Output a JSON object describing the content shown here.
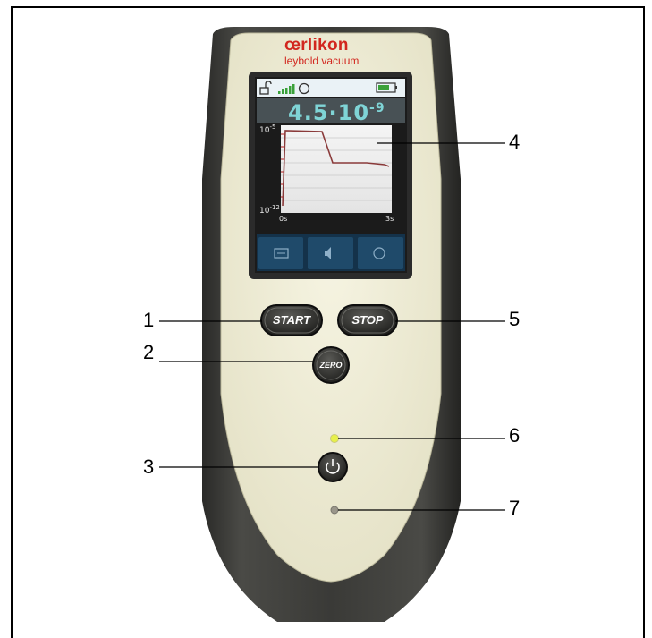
{
  "brand": {
    "name": "œrlikon",
    "subname": "leybold vacuum"
  },
  "screen": {
    "reading_mantissa": "4.5·10",
    "reading_exponent": "-9",
    "y_top_base": "10",
    "y_top_exp": "-5",
    "y_bottom_base": "10",
    "y_bottom_exp": "-12",
    "x_start": "0s",
    "x_end": "3s",
    "softkeys": [
      "menu-icon",
      "speaker-icon",
      "circle-icon"
    ]
  },
  "buttons": {
    "start": "START",
    "stop": "STOP",
    "zero": "ZERO",
    "power": "power-icon"
  },
  "callouts": [
    "1",
    "2",
    "3",
    "4",
    "5",
    "6",
    "7"
  ],
  "colors": {
    "brand": "#d2271f",
    "body": "#3b3b38",
    "face": "#f1efd6",
    "reading": "#7fd4d6",
    "trace": "#8a3a3a",
    "led": "#e7f04a"
  }
}
